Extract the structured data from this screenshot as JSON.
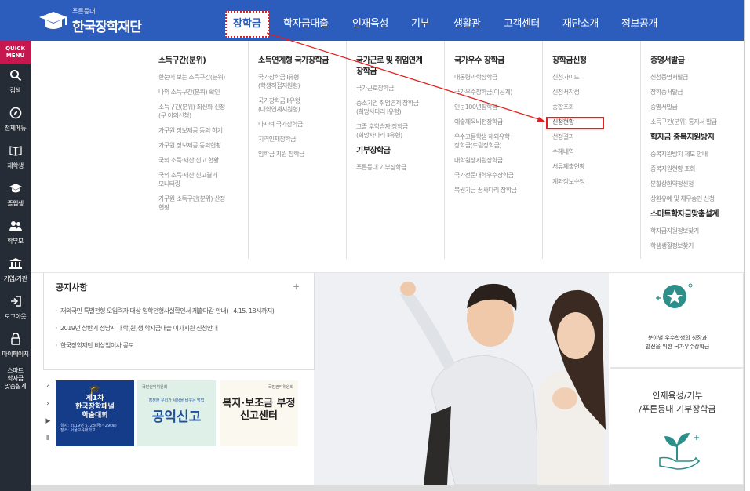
{
  "logo": {
    "tag": "푸른등대",
    "name": "한국장학재단"
  },
  "nav": {
    "active": "장학금",
    "items": [
      "학자금대출",
      "인재육성",
      "기부",
      "생활관",
      "고객센터",
      "재단소개",
      "정보공개"
    ]
  },
  "sidebar": {
    "quick": "QUICK\nMENU",
    "items": [
      {
        "label": "검색",
        "icon": "search-icon"
      },
      {
        "label": "전체메뉴",
        "icon": "compass-icon"
      },
      {
        "label": "재학생",
        "icon": "book-icon"
      },
      {
        "label": "졸업생",
        "icon": "graduation-cap-icon"
      },
      {
        "label": "학부모",
        "icon": "parents-icon"
      },
      {
        "label": "기업/기관",
        "icon": "institution-icon"
      },
      {
        "label": "로그아웃",
        "icon": "logout-icon"
      },
      {
        "label": "마이페이지",
        "icon": "lock-icon"
      },
      {
        "label": "스마트\n학자금\n맞춤설계",
        "icon": "smart-plan-icon"
      }
    ]
  },
  "mega": {
    "col1": {
      "title": "소득구간(분위)",
      "items": [
        "한눈에 보는 소득구간(분위)",
        "나의 소득구간(분위) 확인",
        "소득구간(분위) 최신화 신청\n(구 이의신청)",
        "가구원 정보제공 동의 하기",
        "가구원 정보제공 동의현황",
        "국외 소득·재산 신고 현황",
        "국외 소득·재산 신고결과\n모니터링",
        "가구원 소득구간(분위) 산정\n현황"
      ]
    },
    "col2": {
      "title": "소득연계형 국가장학금",
      "items": [
        "국가장학금 Ⅰ유형\n(학생직접지원형)",
        "국가장학금 Ⅱ유형\n(대학연계지원형)",
        "다자녀 국가장학금",
        "지역인재장학금",
        "입학금 지원 장학금"
      ]
    },
    "col3": {
      "title": "국가근로 및 취업연계\n장학금",
      "items": [
        "국가근로장학금",
        "중소기업 취업연계 장학금\n(희망사다리 Ⅰ유형)",
        "고졸 후학습자 장학금\n(희망사다리 Ⅱ유형)"
      ],
      "sub_title": "기부장학금",
      "sub_items": [
        "푸른등대 기부장학금"
      ]
    },
    "col4": {
      "title": "국가우수 장학금",
      "items": [
        "대통령과학장학금",
        "국가우수장학금(이공계)",
        "인문100년장학금",
        "예술체육비전장학금",
        "우수고등학생 해외유학\n장학금(드림장학금)",
        "대학원생지원장학금",
        "국가전문대학우수장학금",
        "복권기금 꿈사다리 장학금"
      ]
    },
    "col5": {
      "title": "장학금신청",
      "items": [
        "신청가이드",
        "신청서작성",
        "종합조회",
        "신청현황",
        "선정결과",
        "수혜내역",
        "서류제출현황",
        "계좌정보수정"
      ]
    },
    "col6": {
      "title": "증명서발급",
      "items": [
        "신청증명서발급",
        "장학증서발급",
        "증명서발급",
        "소득구간(분위) 통지서 발급"
      ],
      "sub_title": "학자금 중복지원방지",
      "sub_items": [
        "중복지원방지 제도 안내",
        "중복지원현황 조회",
        "분할상환약정신청",
        "상환유예 및 채무승인 신청"
      ],
      "sub2_title": "스마트학자금맞춤설계",
      "sub2_items": [
        "학자금지원정보찾기",
        "학생생활정보찾기"
      ]
    }
  },
  "notice": {
    "title": "공지사항",
    "more": "+",
    "items": [
      "재외국민 특별전형 오입력자 대상 입학전형사실확인서 제출마감 안내(~4.15. 18시까지)",
      "2019년 상반기 성남시 대학(원)생 학자금대출 이자지원 신청안내",
      "한국장학재단 비상임이사 공모"
    ]
  },
  "carousel": {
    "controls": [
      "‹",
      "›",
      "▶",
      "Ⅱ"
    ],
    "banners": [
      {
        "title": "제1차\n한국장학패널\n학술대회",
        "detail": "일자: 2019년 5. 28(금)~29(토)\n장소: 서울교육대학교"
      },
      {
        "top": "국민권익위원회",
        "sub": "정정한 우리가 세상을 바꾸는 방법",
        "title": "공익신고"
      },
      {
        "top": "국민권익위원회",
        "title": "복지·보조금 부정\n신고센터"
      }
    ]
  },
  "promo1": {
    "text": "분야별 우수학생의 성장과\n발전을 위한 국가우수장학금"
  },
  "promo2": {
    "title": "인재육성/기부\n/푸른등대 기부장학금"
  },
  "colors": {
    "nav": "#2c5dbd",
    "sidebar": "#262c36",
    "quick": "#c6184f",
    "highlight": "#e51f1f"
  }
}
